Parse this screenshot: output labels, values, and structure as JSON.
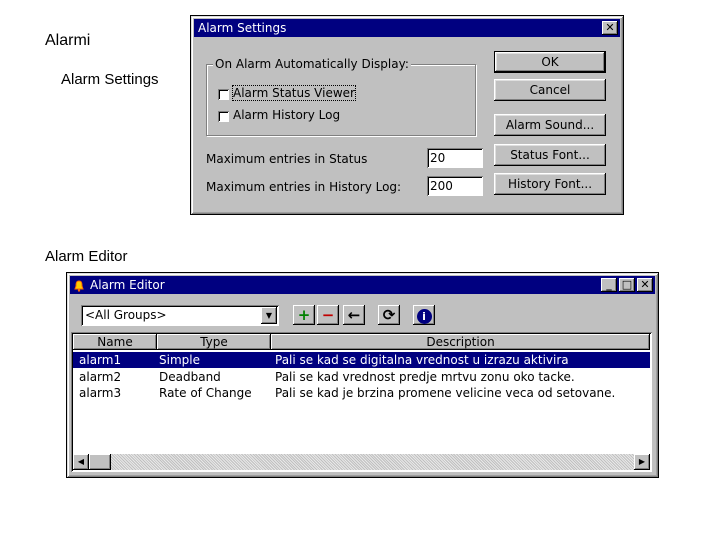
{
  "slide": {
    "heading": "Alarmi",
    "label_settings": "Alarm Settings",
    "label_editor": "Alarm Editor"
  },
  "settings_dialog": {
    "title": "Alarm Settings",
    "close_glyph": "✕",
    "group_label": "On Alarm Automatically Display:",
    "checkbox_status_viewer": "Alarm Status Viewer",
    "checkbox_history_log": "Alarm History Log",
    "max_status_label": "Maximum entries in Status",
    "max_status_value": "20",
    "max_history_label": "Maximum entries in History Log:",
    "max_history_value": "200",
    "buttons": {
      "ok": "OK",
      "cancel": "Cancel",
      "alarm_sound": "Alarm Sound...",
      "status_font": "Status Font...",
      "history_font": "History Font..."
    }
  },
  "editor": {
    "title": "Alarm Editor",
    "minimize_glyph": "_",
    "maximize_glyph": "□",
    "close_glyph": "✕",
    "group_select": "<All Groups>",
    "toolbar": {
      "add_glyph": "+",
      "remove_glyph": "−",
      "back_glyph": "←",
      "refresh_glyph": "⟳",
      "info_glyph": "i"
    },
    "columns": [
      "Name",
      "Type",
      "Description"
    ],
    "rows": [
      {
        "name": "alarm1",
        "type": "Simple",
        "description": "Pali se kad se digitalna vrednost u izrazu aktivira"
      },
      {
        "name": "alarm2",
        "type": "Deadband",
        "description": "Pali se kad vrednost predje mrtvu zonu oko tacke."
      },
      {
        "name": "alarm3",
        "type": "Rate of Change",
        "description": "Pali se kad je brzina promene velicine veca od setovane."
      }
    ],
    "selected_row": 0
  },
  "colors": {
    "titlebar": "#000080",
    "selection": "#000080",
    "window_face": "#c0c0c0"
  }
}
